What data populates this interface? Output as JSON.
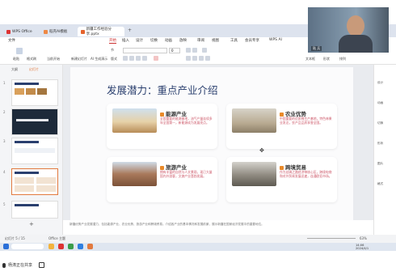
{
  "tabs": [
    {
      "label": "WPS Office"
    },
    {
      "label": "稻壳AI模板"
    },
    {
      "label": "新疆工作经验分享.pptx"
    }
  ],
  "menu": [
    {
      "label": "文件"
    },
    {
      "label": "开始"
    },
    {
      "label": "插入"
    },
    {
      "label": "设计"
    },
    {
      "label": "切换"
    },
    {
      "label": "动画"
    },
    {
      "label": "放映"
    },
    {
      "label": "审阅"
    },
    {
      "label": "视图"
    },
    {
      "label": "工具"
    },
    {
      "label": "会员专享"
    },
    {
      "label": "WPS AI"
    }
  ],
  "ribbon": {
    "paste": "粘贴",
    "format_painter": "格式刷",
    "current_from": "当前开始",
    "new_slide": "新建幻灯片",
    "ai_slide": "AI 生成演示",
    "layout": "版式",
    "section": "节",
    "font_size": "0",
    "textbox": "文本框",
    "shape": "形状",
    "arrange": "排列"
  },
  "leftpane": {
    "header": "大纲",
    "header2": "幻灯片"
  },
  "slide_numbers": [
    "1",
    "2",
    "3",
    "4",
    "5",
    "6"
  ],
  "slide": {
    "title": "发展潜力：重点产业介绍",
    "cards": [
      {
        "title": "能源产业",
        "desc": "全国重要的能源基地，油气产量连续多年全国第一，新能源成为发展亮点。"
      },
      {
        "title": "农业优势",
        "desc": "中国重要的优质棉生产基地，特色林果业发达，农产品品质享誉全国。"
      },
      {
        "title": "旅游产业",
        "desc": "拥有丰富的自然与人文景观，现已大量国内外游客，文旅产业蓬勃发展。"
      },
      {
        "title": "跨境贸易",
        "desc": "作为丝绸之路经济带核心区，跨境电商和对外贸易发展迅速，连通欧亚市场。"
      }
    ]
  },
  "notes": "新疆优势产业发展潜力，包括能源产业、农业优势、旅游产业和跨境贸易。介绍各产业的基本情况和发展前景，展示新疆在国家经济发展中的重要地位。",
  "statusbar": {
    "slide_info": "幻灯片 5 / 15",
    "theme": "Office 主题",
    "zoom": "63%"
  },
  "rightpanel": [
    "设计",
    "动画",
    "切换",
    "形状",
    "图片",
    "格式"
  ],
  "taskbar_time": "14:06",
  "taskbar_date": "2024/4/1",
  "video_label": "陆 兵",
  "share_text": "杨涛正在共享"
}
